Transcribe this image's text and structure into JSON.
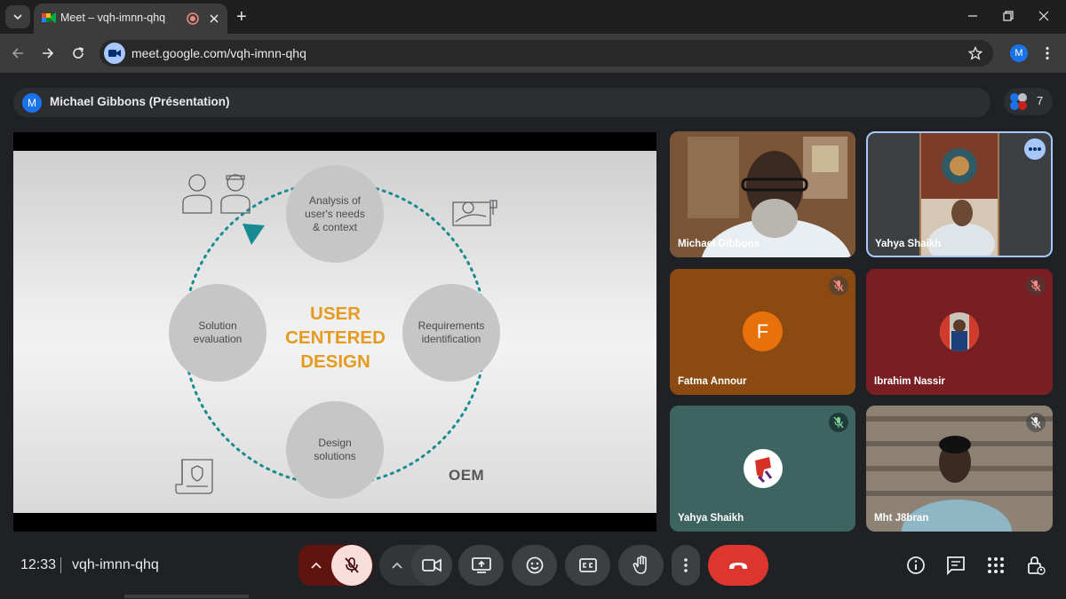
{
  "browser": {
    "tab_title": "Meet – vqh-imnn-qhq",
    "new_tab_symbol": "+",
    "url": "meet.google.com/vqh-imnn-qhq",
    "profile_initial": "M"
  },
  "meeting": {
    "presenter_initial": "M",
    "presenter_label": "Michael Gibbons (Présentation)",
    "participant_count": "7",
    "time": "12:33",
    "code": "vqh-imnn-qhq"
  },
  "slide": {
    "center_title": "USER\nCENTERED\nDESIGN",
    "nodes": {
      "analysis": "Analysis of\nuser's needs\n& context",
      "requirements": "Requirements\nidentification",
      "design": "Design\nsolutions",
      "evaluation": "Solution\nevaluation"
    },
    "brand": "OEM"
  },
  "participants": [
    {
      "name": "Michael Gibbons",
      "muted": false,
      "type": "video"
    },
    {
      "name": "Yahya Shaikh",
      "muted": false,
      "type": "video",
      "active": true
    },
    {
      "name": "Fatma Annour",
      "muted": true,
      "type": "initial",
      "initial": "F",
      "bg": "#8a4a12",
      "avatar_color": "#e8710a"
    },
    {
      "name": "Ibrahim Nassir",
      "muted": true,
      "type": "photo-avatar",
      "bg": "#7a1f21"
    },
    {
      "name": "Yahya Shaikh",
      "muted": true,
      "type": "photo-avatar",
      "bg": "#3e6461"
    },
    {
      "name": "Mht J8bran",
      "muted": true,
      "type": "video"
    }
  ],
  "colors": {
    "accent_orange": "#e59b21",
    "teal_arrow": "#178b8f",
    "leave_red": "#ea4335",
    "mic_off_bg": "#f9dedc"
  }
}
